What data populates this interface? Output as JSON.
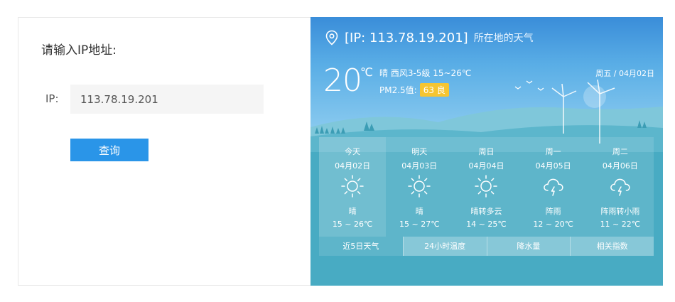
{
  "query": {
    "title": "请输入IP地址:",
    "ip_label": "IP:",
    "ip_value": "113.78.19.201",
    "button_label": "查询"
  },
  "weather": {
    "header_ip": "[IP: 113.78.19.201]",
    "header_suffix": "所在地的天气",
    "current_temp": "20",
    "temp_unit": "℃",
    "current_desc": "晴  西风3-5级  15~26℃",
    "pm_label": "PM2.5值:",
    "pm_badge": "63 良",
    "date": "周五 / 04月02日",
    "forecast": [
      {
        "name": "今天",
        "date": "04月02日",
        "icon": "sun-icon",
        "cond": "晴",
        "range": "15 ~ 26℃"
      },
      {
        "name": "明天",
        "date": "04月03日",
        "icon": "sun-icon",
        "cond": "晴",
        "range": "15 ~ 27℃"
      },
      {
        "name": "周日",
        "date": "04月04日",
        "icon": "sun-icon",
        "cond": "晴转多云",
        "range": "14 ~ 25℃"
      },
      {
        "name": "周一",
        "date": "04月05日",
        "icon": "thunder-cloud-icon",
        "cond": "阵雨",
        "range": "12 ~ 20℃"
      },
      {
        "name": "周二",
        "date": "04月06日",
        "icon": "thunder-cloud-icon",
        "cond": "阵雨转小雨",
        "range": "11 ~ 22℃"
      }
    ],
    "tabs": [
      "近5日天气",
      "24小时温度",
      "降水量",
      "相关指数"
    ]
  },
  "colors": {
    "accent_button": "#2a95e8",
    "weather_bg": "#48abc3",
    "pm_badge": "#f5c531"
  }
}
